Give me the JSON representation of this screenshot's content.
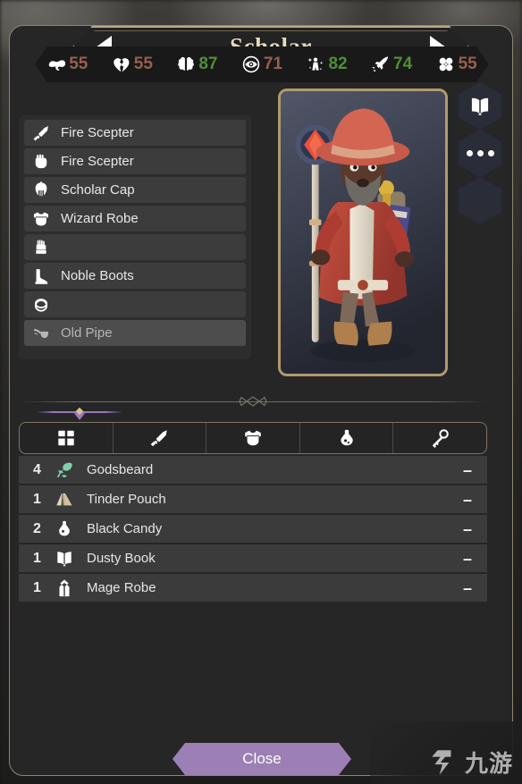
{
  "header": {
    "title": "Scholar",
    "prev_label": "prev-class",
    "next_label": "next-class"
  },
  "stats": [
    {
      "icon": "strength-icon",
      "value": "55",
      "color": "#97604c"
    },
    {
      "icon": "broken-heart-icon",
      "value": "55",
      "color": "#97604c"
    },
    {
      "icon": "brain-icon",
      "value": "87",
      "color": "#4f8f38"
    },
    {
      "icon": "eye-icon",
      "value": "71",
      "color": "#97604c"
    },
    {
      "icon": "magic-icon",
      "value": "82",
      "color": "#4f8f38"
    },
    {
      "icon": "speed-icon",
      "value": "74",
      "color": "#4f8f38"
    },
    {
      "icon": "clover-icon",
      "value": "55",
      "color": "#97604c"
    }
  ],
  "equipment": [
    {
      "slot": "main-hand",
      "icon": "sword-icon",
      "name": "Fire Scepter",
      "empty": false,
      "dim": false
    },
    {
      "slot": "off-hand",
      "icon": "fist-icon",
      "name": "Fire Scepter",
      "empty": false,
      "dim": false
    },
    {
      "slot": "head",
      "icon": "helmet-icon",
      "name": "Scholar Cap",
      "empty": false,
      "dim": false
    },
    {
      "slot": "chest",
      "icon": "armor-icon",
      "name": "Wizard Robe",
      "empty": false,
      "dim": false
    },
    {
      "slot": "hands",
      "icon": "glove-icon",
      "name": "",
      "empty": true,
      "dim": false
    },
    {
      "slot": "feet",
      "icon": "boot-icon",
      "name": "Noble Boots",
      "empty": false,
      "dim": false
    },
    {
      "slot": "ring",
      "icon": "ring-icon",
      "name": "",
      "empty": true,
      "dim": false
    },
    {
      "slot": "trinket",
      "icon": "pipe-icon",
      "name": "Old Pipe",
      "empty": false,
      "dim": true
    }
  ],
  "side_buttons": [
    {
      "icon": "book-icon",
      "label": "journal"
    },
    {
      "icon": "dots-icon",
      "label": "more-options"
    },
    {
      "icon": "blank-icon",
      "label": "empty-slot"
    }
  ],
  "inventory_tabs": [
    {
      "icon": "all-items-icon",
      "label": "All",
      "selected": true
    },
    {
      "icon": "sword-icon",
      "label": "Weapons",
      "selected": false
    },
    {
      "icon": "armor-icon",
      "label": "Armor",
      "selected": false
    },
    {
      "icon": "potion-icon",
      "label": "Potions",
      "selected": false
    },
    {
      "icon": "key-icon",
      "label": "Misc",
      "selected": false
    }
  ],
  "inventory": [
    {
      "qty": "4",
      "icon": "herb-icon",
      "name": "Godsbeard",
      "action": "–"
    },
    {
      "qty": "1",
      "icon": "pouch-icon",
      "name": "Tinder Pouch",
      "action": "–"
    },
    {
      "qty": "2",
      "icon": "flask-icon",
      "name": "Black Candy",
      "action": "–"
    },
    {
      "qty": "1",
      "icon": "book-icon",
      "name": "Dusty Book",
      "action": "–"
    },
    {
      "qty": "1",
      "icon": "robe-icon",
      "name": "Mage Robe",
      "action": "–"
    }
  ],
  "footer": {
    "close_label": "Close"
  },
  "watermark": {
    "text": "九游"
  },
  "colors": {
    "panel_border": "#8e8670",
    "accent_purple": "#9b7fb5",
    "title_gold": "#e4dcbd",
    "stat_red": "#97604c",
    "stat_green": "#4f8f38"
  }
}
